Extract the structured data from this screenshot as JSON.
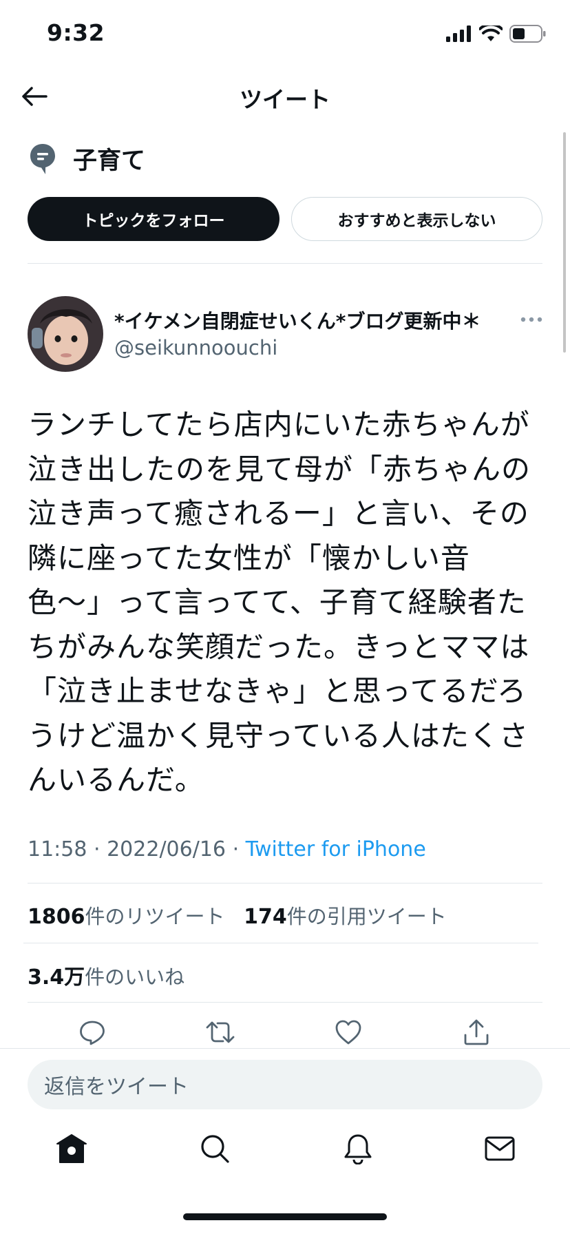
{
  "status_bar": {
    "time": "9:32"
  },
  "header": {
    "title": "ツイート"
  },
  "topic": {
    "name": "子育て",
    "follow_label": "トピックをフォロー",
    "hide_label": "おすすめと表示しない"
  },
  "tweet": {
    "display_name": "*イケメン自閉症せいくん*ブログ更新中＊",
    "handle": "@seikunnoouchi",
    "text_lines": [
      "ランチしてたら店内にいた赤ちゃんが",
      "泣き出したのを見て母が「赤ちゃんの",
      "泣き声って癒されるー」と言い、その",
      "隣に座ってた女性が「懐かしい音",
      "色〜」って言ってて、子育て経験者た",
      "ちがみんな笑顔だった。きっとママは",
      "「泣き止ませなきゃ」と思ってるだろ",
      "うけど温かく見守っている人はたくさ",
      "んいるんだ。"
    ],
    "time": "11:58",
    "date": "2022/06/16",
    "source": "Twitter for iPhone",
    "retweet_count": "1806",
    "retweet_label": "件のリツイート",
    "quote_count": "174",
    "quote_label": "件の引用ツイート",
    "like_count": "3.4万",
    "like_label": "件のいいね"
  },
  "actions": [
    "reply-icon",
    "retweet-icon",
    "like-icon",
    "share-icon"
  ],
  "reply_bar": {
    "placeholder": "返信をツイート"
  },
  "nav": [
    "home-icon",
    "search-icon",
    "notifications-icon",
    "messages-icon"
  ],
  "colors": {
    "accent": "#1d9bf0",
    "text": "#0f1419",
    "secondary": "#536471"
  }
}
